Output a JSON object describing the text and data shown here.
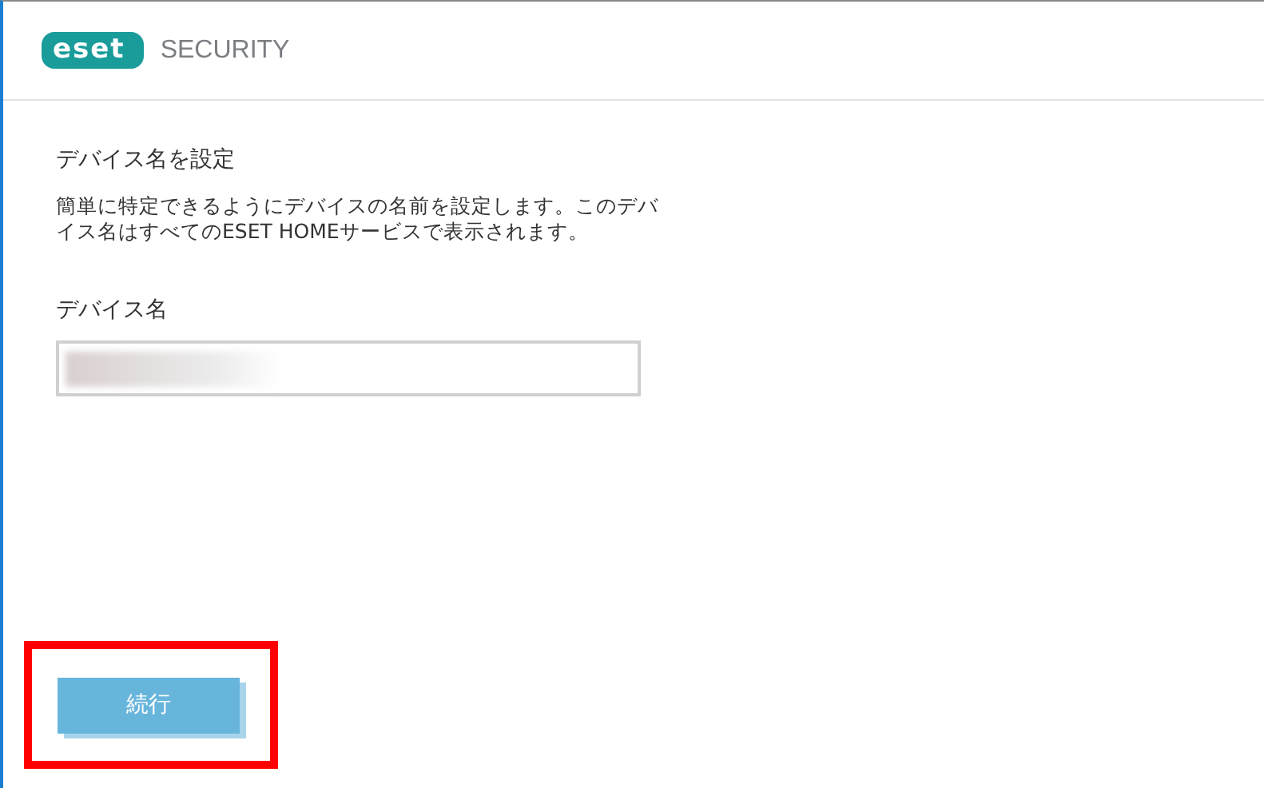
{
  "header": {
    "logo": "eset",
    "product": "SECURITY"
  },
  "title": "デバイス名を設定",
  "description": "簡単に特定できるようにデバイスの名前を設定します。このデバイス名はすべてのESET HOMEサービスで表示されます。",
  "field": {
    "label": "デバイス名",
    "value_blurred": true
  },
  "button": {
    "label": "続行",
    "highlighted": true
  }
}
